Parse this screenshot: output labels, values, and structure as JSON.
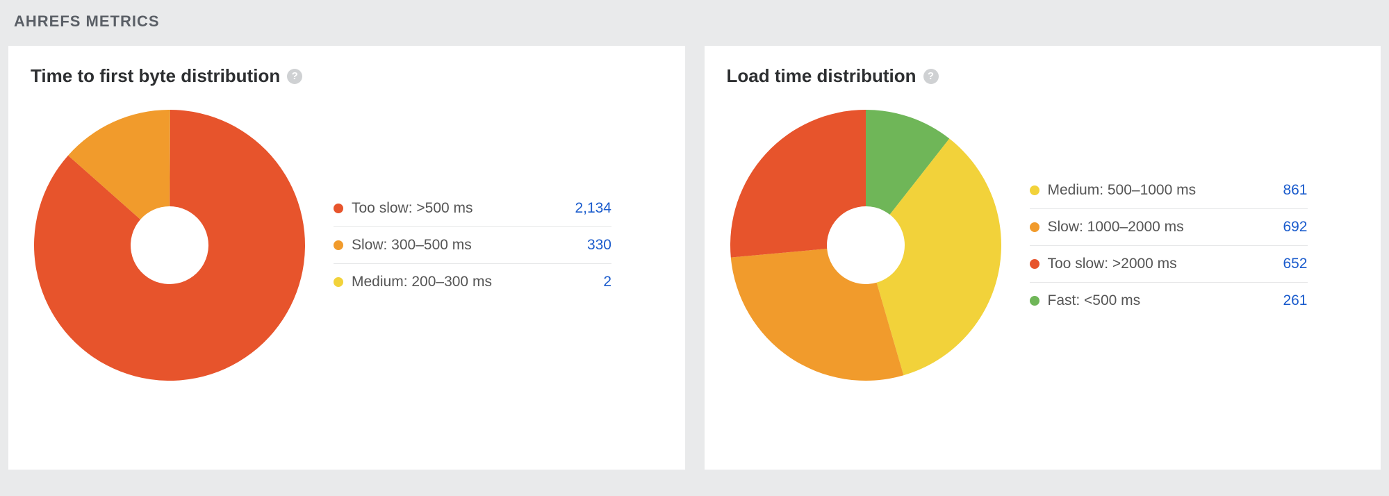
{
  "section_title": "AHREFS METRICS",
  "colors": {
    "red": "#e7542c",
    "orange": "#f19b2c",
    "yellow": "#f2d23a",
    "green": "#6fb658"
  },
  "cards": [
    {
      "title": "Time to first byte distribution",
      "legend": [
        {
          "label": "Too slow: >500 ms",
          "value_display": "2,134",
          "value": 2134,
          "color_key": "red"
        },
        {
          "label": "Slow: 300–500 ms",
          "value_display": "330",
          "value": 330,
          "color_key": "orange"
        },
        {
          "label": "Medium: 200–300 ms",
          "value_display": "2",
          "value": 2,
          "color_key": "yellow"
        }
      ]
    },
    {
      "title": "Load time distribution",
      "legend": [
        {
          "label": "Medium: 500–1000 ms",
          "value_display": "861",
          "value": 861,
          "color_key": "yellow"
        },
        {
          "label": "Slow: 1000–2000 ms",
          "value_display": "692",
          "value": 692,
          "color_key": "orange"
        },
        {
          "label": "Too slow: >2000 ms",
          "value_display": "652",
          "value": 652,
          "color_key": "red"
        },
        {
          "label": "Fast: <500 ms",
          "value_display": "261",
          "value": 261,
          "color_key": "green"
        }
      ]
    }
  ],
  "chart_data": [
    {
      "type": "pie",
      "title": "Time to first byte distribution",
      "series": [
        {
          "name": "Too slow: >500 ms",
          "value": 2134
        },
        {
          "name": "Slow: 300–500 ms",
          "value": 330
        },
        {
          "name": "Medium: 200–300 ms",
          "value": 2
        }
      ]
    },
    {
      "type": "pie",
      "title": "Load time distribution",
      "series": [
        {
          "name": "Medium: 500–1000 ms",
          "value": 861
        },
        {
          "name": "Slow: 1000–2000 ms",
          "value": 692
        },
        {
          "name": "Too slow: >2000 ms",
          "value": 652
        },
        {
          "name": "Fast: <500 ms",
          "value": 261
        }
      ]
    }
  ],
  "donut_draw_order": [
    [
      "red",
      "orange",
      "yellow"
    ],
    [
      "green",
      "yellow",
      "orange",
      "red"
    ]
  ]
}
